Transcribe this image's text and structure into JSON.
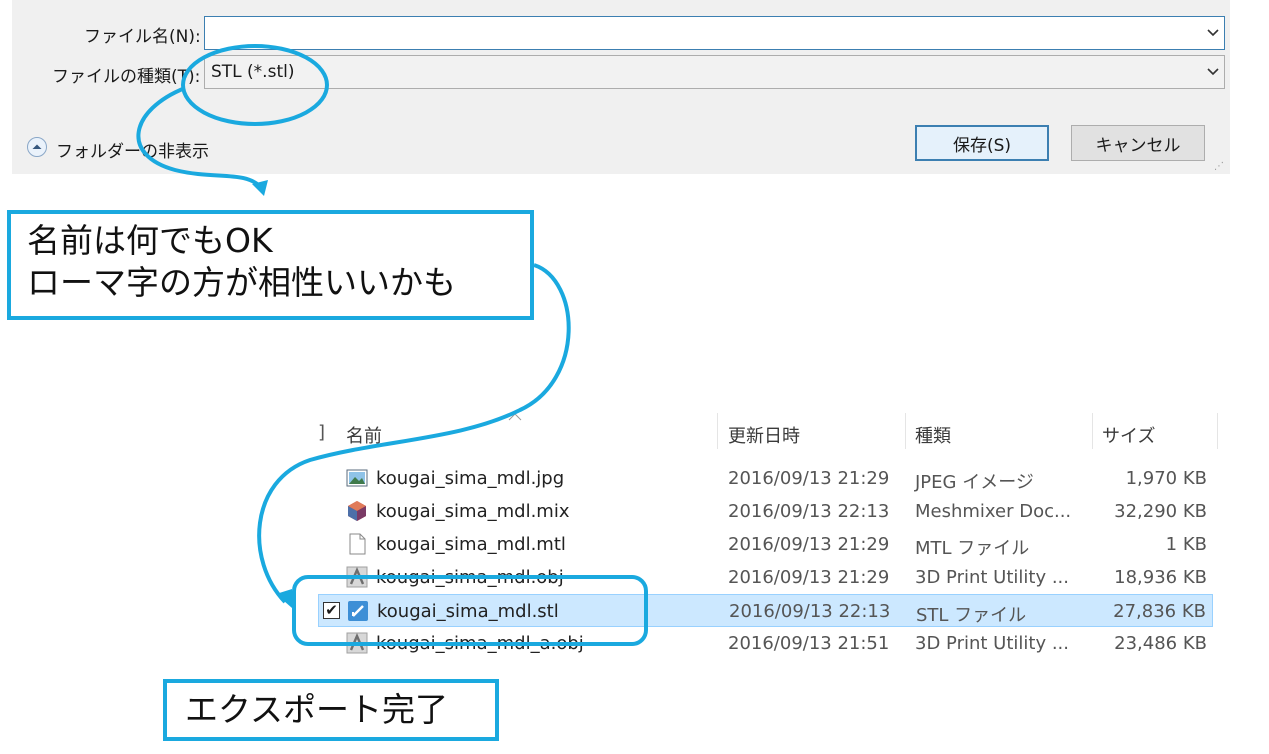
{
  "dialog": {
    "filename_label": "ファイル名(N):",
    "filename_value": "",
    "filetype_label": "ファイルの種類(T):",
    "filetype_value": "STL (*.stl)",
    "folder_toggle_label": "フォルダーの非表示",
    "save_button": "保存(S)",
    "cancel_button": "キャンセル",
    "dropdown_icon": "chevron-down-icon",
    "toggle_icon": "chevron-up-circle-icon"
  },
  "callouts": {
    "filename_note_line1": "名前は何でもOK",
    "filename_note_line2": "ローマ字の方が相性いいかも",
    "export_done": "エクスポート完了"
  },
  "file_list": {
    "columns": [
      "名前",
      "更新日時",
      "種類",
      "サイズ"
    ],
    "rows": [
      {
        "name": "kougai_sima_mdl.jpg",
        "date": "2016/09/13 21:29",
        "type": "JPEG イメージ",
        "size": "1,970 KB",
        "icon": "image-file-icon",
        "selected": false
      },
      {
        "name": "kougai_sima_mdl.mix",
        "date": "2016/09/13 22:13",
        "type": "Meshmixer Doc...",
        "size": "32,290 KB",
        "icon": "meshmixer-file-icon",
        "selected": false
      },
      {
        "name": "kougai_sima_mdl.mtl",
        "date": "2016/09/13 21:29",
        "type": "MTL ファイル",
        "size": "1 KB",
        "icon": "blank-file-icon",
        "selected": false
      },
      {
        "name": "kougai_sima_mdl.obj",
        "date": "2016/09/13 21:29",
        "type": "3D Print Utility ...",
        "size": "18,936 KB",
        "icon": "3d-print-file-icon",
        "selected": false
      },
      {
        "name": "kougai_sima_mdl.stl",
        "date": "2016/09/13 22:13",
        "type": "STL ファイル",
        "size": "27,836 KB",
        "icon": "stl-file-icon",
        "selected": true
      },
      {
        "name": "kougai_sima_mdl_a.obj",
        "date": "2016/09/13 21:51",
        "type": "3D Print Utility ...",
        "size": "23,486 KB",
        "icon": "3d-print-file-icon",
        "selected": false
      }
    ]
  },
  "colors": {
    "callout_accent": "#1aa9df",
    "selection_bg": "#cce8ff",
    "dialog_bg": "#f0f0f0"
  }
}
